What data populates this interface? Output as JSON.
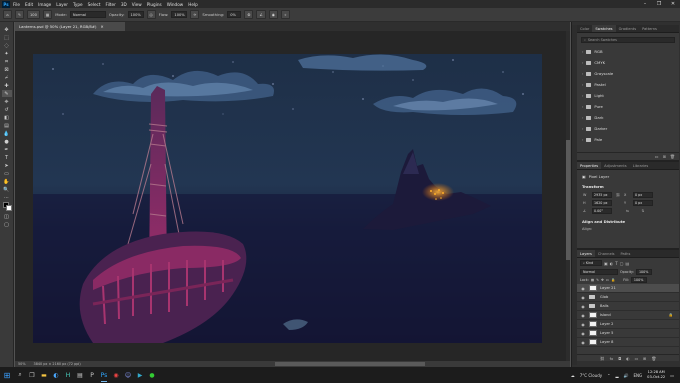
{
  "menubar": {
    "logo": "Ps",
    "items": [
      "File",
      "Edit",
      "Image",
      "Layer",
      "Type",
      "Select",
      "Filter",
      "3D",
      "View",
      "Plugins",
      "Window",
      "Help"
    ]
  },
  "options": {
    "mode_label": "Mode:",
    "mode_value": "Normal",
    "opacity_label": "Opacity:",
    "opacity_value": "100%",
    "flow_label": "Flow:",
    "flow_value": "100%",
    "smoothing_label": "Smoothing:",
    "smoothing_value": "0%",
    "brush_size": "100"
  },
  "document": {
    "tab_label": "Lanterns.psd @ 50% (Layer 21, RGB/8#)",
    "zoom": "50%",
    "doc_size": "3840 px × 2160 px (72 ppi)"
  },
  "swatches_panel": {
    "tabs": [
      "Color",
      "Swatches",
      "Gradients",
      "Patterns"
    ],
    "active_tab": "Swatches",
    "search_placeholder": "Search Swatches",
    "groups": [
      "RGB",
      "CMYK",
      "Grayscale",
      "Pastel",
      "Light",
      "Pure",
      "Dark",
      "Darker",
      "Pale"
    ]
  },
  "properties_panel": {
    "tabs": [
      "Properties",
      "Adjustments",
      "Libraries"
    ],
    "active_tab": "Properties",
    "layer_type": "Pixel Layer",
    "transform_title": "Transform",
    "w_label": "W",
    "w_value": "2935 px",
    "x_label": "X",
    "x_value": "0 px",
    "h_label": "H",
    "h_value": "1620 px",
    "y_label": "Y",
    "y_value": "0 px",
    "angle_value": "0.00°",
    "align_title": "Align and Distribute",
    "align_sub": "Align:"
  },
  "layers_panel": {
    "tabs": [
      "Layers",
      "Channels",
      "Paths"
    ],
    "active_tab": "Layers",
    "filter_kind": "Kind",
    "blend_mode": "Normal",
    "opacity_label": "Opacity:",
    "opacity_value": "100%",
    "lock_label": "Lock:",
    "fill_label": "Fill:",
    "fill_value": "100%",
    "layers": [
      {
        "name": "Layer 21",
        "type": "pixel",
        "selected": true
      },
      {
        "name": "Glob",
        "type": "group",
        "selected": false
      },
      {
        "name": "Balls",
        "type": "group",
        "selected": false
      },
      {
        "name": "Island",
        "type": "pixel",
        "selected": false,
        "locked": true
      },
      {
        "name": "Layer 2",
        "type": "pixel",
        "selected": false
      },
      {
        "name": "Layer 5",
        "type": "pixel",
        "selected": false
      },
      {
        "name": "Layer 8",
        "type": "pixel",
        "selected": false
      }
    ]
  },
  "taskbar": {
    "weather": "7°C  Cloudy",
    "lang": "ENG",
    "time": "12:28 AM",
    "date": "03-Oct-22"
  },
  "colors": {
    "sky_top": "#1a2940",
    "sea": "#141a32",
    "ship": "#8a2a64",
    "lantern": "#ff9a1a",
    "accent": "#31a8ff"
  }
}
